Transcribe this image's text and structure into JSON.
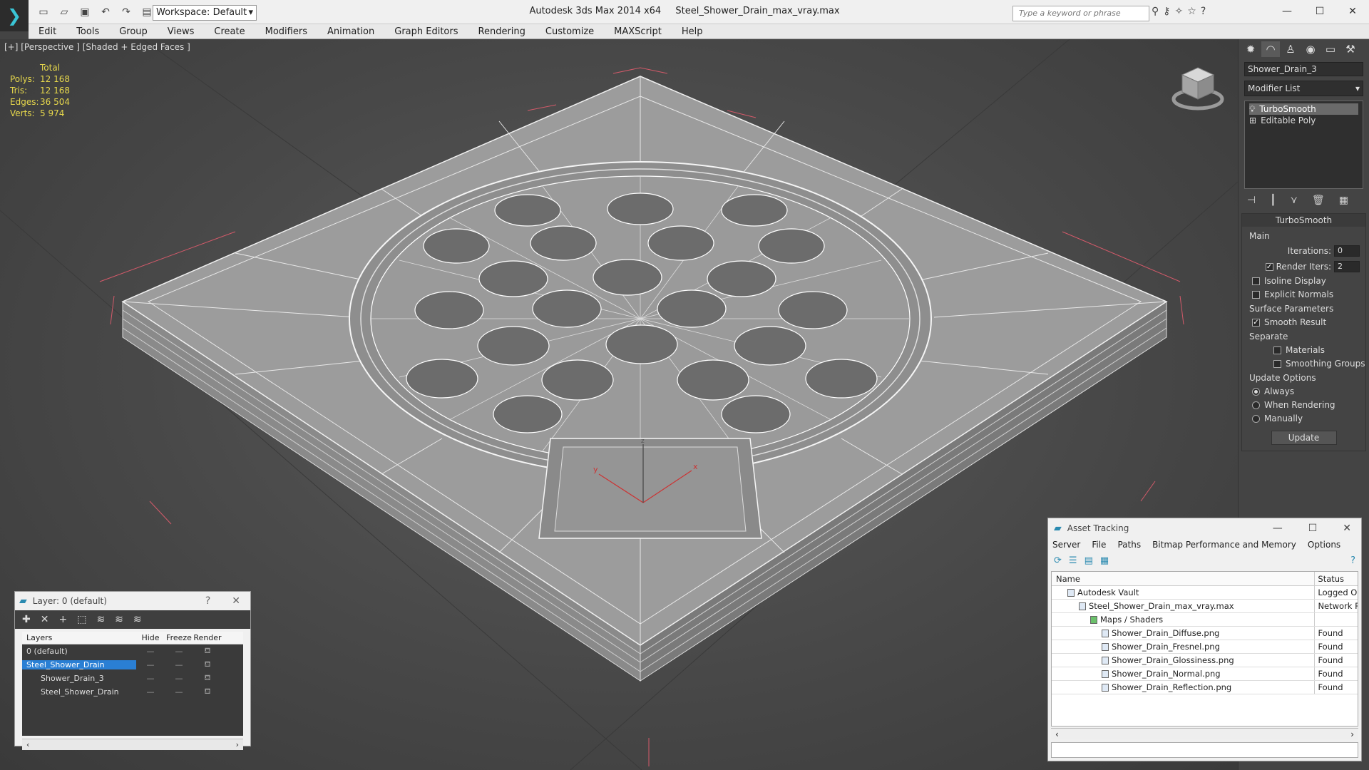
{
  "titlebar": {
    "app": "Autodesk 3ds Max  2014 x64",
    "file": "Steel_Shower_Drain_max_vray.max",
    "workspace": "Workspace: Default",
    "search_placeholder": "Type a keyword or phrase"
  },
  "menu": [
    "Edit",
    "Tools",
    "Group",
    "Views",
    "Create",
    "Modifiers",
    "Animation",
    "Graph Editors",
    "Rendering",
    "Customize",
    "MAXScript",
    "Help"
  ],
  "viewport": {
    "label": "[+] [Perspective ] [Shaded + Edged Faces ]",
    "stats_header": "Total",
    "stats": [
      {
        "label": "Polys:",
        "value": "12 168"
      },
      {
        "label": "Tris:",
        "value": "12 168"
      },
      {
        "label": "Edges:",
        "value": "36 504"
      },
      {
        "label": "Verts:",
        "value": "5 974"
      }
    ],
    "axis_x": "x",
    "axis_y": "y",
    "axis_z": "z"
  },
  "command_panel": {
    "object_name": "Shower_Drain_3",
    "modifier_list": "Modifier List",
    "stack": [
      "TurboSmooth",
      "Editable Poly"
    ],
    "rollout_title": "TurboSmooth",
    "main_label": "Main",
    "iterations_label": "Iterations:",
    "iterations_value": "0",
    "render_iters_label": "Render Iters:",
    "render_iters_value": "2",
    "isoline": "Isoline Display",
    "explicit_normals": "Explicit Normals",
    "surface_params": "Surface Parameters",
    "smooth_result": "Smooth Result",
    "separate": "Separate",
    "materials": "Materials",
    "smoothing_groups": "Smoothing Groups",
    "update_options": "Update Options",
    "always": "Always",
    "when_rendering": "When Rendering",
    "manually": "Manually",
    "update_button": "Update"
  },
  "layer_dialog": {
    "title": "Layer: 0 (default)",
    "help": "?",
    "close": "✕",
    "columns": [
      "Layers",
      "Hide",
      "Freeze",
      "Render"
    ],
    "rows": [
      "0 (default)",
      "Steel_Shower_Drain",
      "Shower_Drain_3",
      "Steel_Shower_Drain"
    ]
  },
  "asset_dialog": {
    "title": "Asset Tracking",
    "menu": [
      "Server",
      "File",
      "Paths",
      "Bitmap Performance and Memory",
      "Options"
    ],
    "col_name": "Name",
    "col_status": "Status",
    "rows": [
      {
        "name": "Autodesk Vault",
        "status": "Logged Ou"
      },
      {
        "name": "Steel_Shower_Drain_max_vray.max",
        "status": "Network P"
      },
      {
        "name": "Maps / Shaders",
        "status": ""
      },
      {
        "name": "Shower_Drain_Diffuse.png",
        "status": "Found"
      },
      {
        "name": "Shower_Drain_Fresnel.png",
        "status": "Found"
      },
      {
        "name": "Shower_Drain_Glossiness.png",
        "status": "Found"
      },
      {
        "name": "Shower_Drain_Normal.png",
        "status": "Found"
      },
      {
        "name": "Shower_Drain_Reflection.png",
        "status": "Found"
      }
    ]
  }
}
